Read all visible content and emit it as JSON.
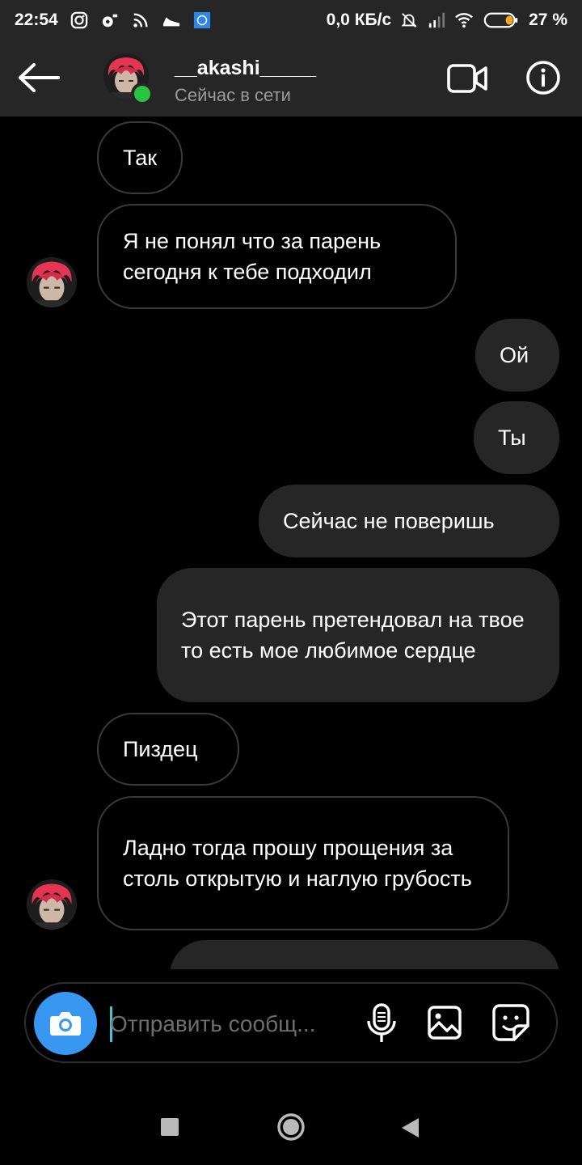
{
  "status_bar": {
    "time": "22:54",
    "speed": "0,0 КБ/с",
    "battery": "27 %",
    "icons": [
      "instagram-icon",
      "music-icon",
      "rss-icon",
      "sneaker-icon",
      "app-icon",
      "mute-icon",
      "signal-icon",
      "wifi-icon",
      "battery-icon"
    ]
  },
  "header": {
    "username": "__akashi_____",
    "status": "Сейчас в сети"
  },
  "messages": [
    {
      "side": "in",
      "text": "Так"
    },
    {
      "side": "in",
      "text": "Я не понял что за парень сегодня к тебе подходил"
    },
    {
      "side": "out",
      "text": "Ой"
    },
    {
      "side": "out",
      "text": "Ты"
    },
    {
      "side": "out",
      "text": "Сейчас не поверишь"
    },
    {
      "side": "out",
      "text": "Этот парень претендовал на твое то есть мое любимое сердце"
    },
    {
      "side": "in",
      "text": "Пиздец"
    },
    {
      "side": "in",
      "text": "Ладно тогда прошу прощения за столь открытую и наглую грубость"
    },
    {
      "side": "out",
      "text": ""
    }
  ],
  "composer": {
    "placeholder": "Отправить сообщ..."
  },
  "colors": {
    "background": "#000000",
    "header": "#262626",
    "outgoing_bubble": "#262626",
    "incoming_border": "#3a3a3a",
    "accent_blue": "#3897f0",
    "online_green": "#2bc240"
  }
}
